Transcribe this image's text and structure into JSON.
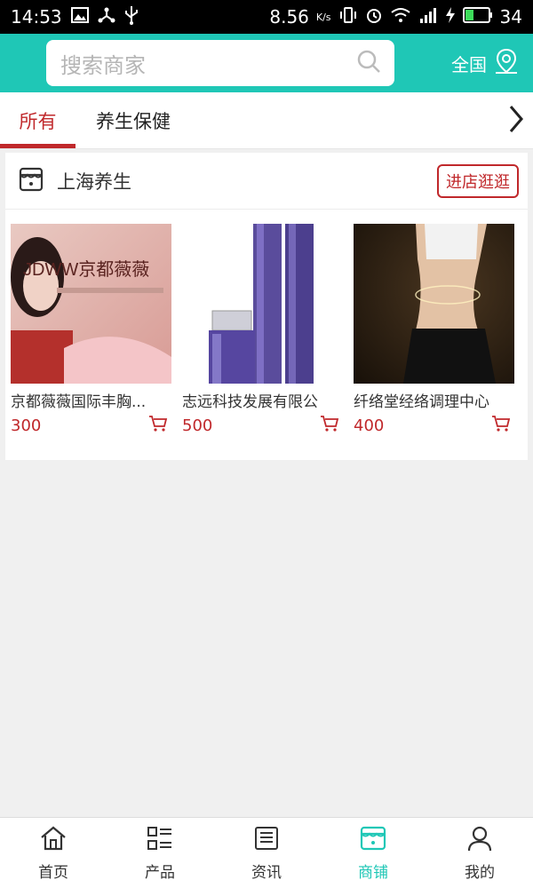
{
  "status_bar": {
    "time": "14:53",
    "speed": "8.56",
    "speed_unit": "K/s",
    "battery": "34"
  },
  "search": {
    "placeholder": "搜索商家"
  },
  "region": {
    "label": "全国"
  },
  "tabs": [
    {
      "label": "所有",
      "active": true
    },
    {
      "label": "养生保健",
      "active": false
    }
  ],
  "shop": {
    "name": "上海养生",
    "visit_label": "进店逛逛",
    "products": [
      {
        "name": "京都薇薇国际丰胸...",
        "price": "300",
        "image_text": "JDWW京都薇薇"
      },
      {
        "name": "志远科技发展有限公",
        "price": "500"
      },
      {
        "name": "纤络堂经络调理中心",
        "price": "400"
      }
    ]
  },
  "bottom_nav": [
    {
      "label": "首页",
      "icon": "home-icon"
    },
    {
      "label": "产品",
      "icon": "list-icon"
    },
    {
      "label": "资讯",
      "icon": "news-icon"
    },
    {
      "label": "商铺",
      "icon": "store-icon",
      "active": true
    },
    {
      "label": "我的",
      "icon": "user-icon"
    }
  ],
  "colors": {
    "accent": "#1fc7b6",
    "brand_red": "#c0282b"
  }
}
